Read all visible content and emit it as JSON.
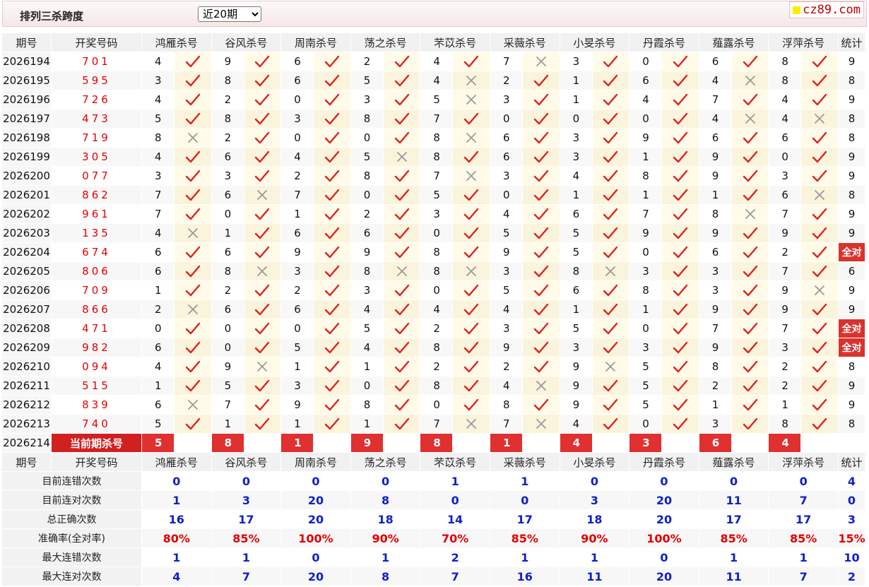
{
  "header": {
    "title": "排列三杀跨度",
    "period_selected": "近20期",
    "logo": "cz89.com"
  },
  "table": {
    "head": [
      "期号",
      "开奖号码",
      "鸿雁杀号",
      "谷风杀号",
      "周南杀号",
      "荡之杀号",
      "芣苡杀号",
      "采薇杀号",
      "小旻杀号",
      "丹霞杀号",
      "薤露杀号",
      "浮萍杀号",
      "统计"
    ],
    "rows": [
      {
        "id": "2026194",
        "num": "701",
        "k": [
          [
            4,
            1
          ],
          [
            9,
            1
          ],
          [
            6,
            1
          ],
          [
            2,
            1
          ],
          [
            4,
            1
          ],
          [
            7,
            0
          ],
          [
            3,
            1
          ],
          [
            0,
            1
          ],
          [
            6,
            1
          ],
          [
            8,
            1
          ]
        ],
        "stat": "9"
      },
      {
        "id": "2026195",
        "num": "595",
        "k": [
          [
            3,
            1
          ],
          [
            8,
            1
          ],
          [
            6,
            1
          ],
          [
            5,
            1
          ],
          [
            4,
            0
          ],
          [
            2,
            1
          ],
          [
            1,
            1
          ],
          [
            6,
            1
          ],
          [
            4,
            0
          ],
          [
            8,
            1
          ]
        ],
        "stat": "8"
      },
      {
        "id": "2026196",
        "num": "726",
        "k": [
          [
            4,
            1
          ],
          [
            2,
            1
          ],
          [
            0,
            1
          ],
          [
            3,
            1
          ],
          [
            5,
            0
          ],
          [
            3,
            1
          ],
          [
            1,
            1
          ],
          [
            4,
            1
          ],
          [
            7,
            1
          ],
          [
            4,
            1
          ]
        ],
        "stat": "9"
      },
      {
        "id": "2026197",
        "num": "473",
        "k": [
          [
            5,
            1
          ],
          [
            8,
            1
          ],
          [
            3,
            1
          ],
          [
            8,
            1
          ],
          [
            7,
            1
          ],
          [
            0,
            1
          ],
          [
            0,
            1
          ],
          [
            0,
            1
          ],
          [
            4,
            0
          ],
          [
            4,
            0
          ]
        ],
        "stat": "8"
      },
      {
        "id": "2026198",
        "num": "719",
        "k": [
          [
            8,
            0
          ],
          [
            2,
            1
          ],
          [
            0,
            1
          ],
          [
            0,
            1
          ],
          [
            8,
            0
          ],
          [
            6,
            1
          ],
          [
            3,
            1
          ],
          [
            9,
            1
          ],
          [
            6,
            1
          ],
          [
            6,
            1
          ]
        ],
        "stat": "8"
      },
      {
        "id": "2026199",
        "num": "305",
        "k": [
          [
            4,
            1
          ],
          [
            6,
            1
          ],
          [
            4,
            1
          ],
          [
            5,
            0
          ],
          [
            8,
            1
          ],
          [
            6,
            1
          ],
          [
            3,
            1
          ],
          [
            1,
            1
          ],
          [
            9,
            1
          ],
          [
            0,
            1
          ]
        ],
        "stat": "9"
      },
      {
        "id": "2026200",
        "num": "077",
        "k": [
          [
            3,
            1
          ],
          [
            3,
            1
          ],
          [
            2,
            1
          ],
          [
            8,
            1
          ],
          [
            7,
            0
          ],
          [
            3,
            1
          ],
          [
            4,
            1
          ],
          [
            8,
            1
          ],
          [
            9,
            1
          ],
          [
            3,
            1
          ]
        ],
        "stat": "9"
      },
      {
        "id": "2026201",
        "num": "862",
        "k": [
          [
            7,
            1
          ],
          [
            6,
            0
          ],
          [
            7,
            1
          ],
          [
            0,
            1
          ],
          [
            5,
            1
          ],
          [
            0,
            1
          ],
          [
            1,
            1
          ],
          [
            1,
            1
          ],
          [
            1,
            1
          ],
          [
            6,
            0
          ]
        ],
        "stat": "8"
      },
      {
        "id": "2026202",
        "num": "961",
        "k": [
          [
            7,
            1
          ],
          [
            0,
            1
          ],
          [
            1,
            1
          ],
          [
            2,
            1
          ],
          [
            3,
            1
          ],
          [
            4,
            1
          ],
          [
            6,
            1
          ],
          [
            7,
            1
          ],
          [
            8,
            0
          ],
          [
            7,
            1
          ]
        ],
        "stat": "9"
      },
      {
        "id": "2026203",
        "num": "135",
        "k": [
          [
            4,
            0
          ],
          [
            1,
            1
          ],
          [
            6,
            1
          ],
          [
            6,
            1
          ],
          [
            0,
            1
          ],
          [
            5,
            1
          ],
          [
            5,
            1
          ],
          [
            9,
            1
          ],
          [
            9,
            1
          ],
          [
            9,
            1
          ]
        ],
        "stat": "9"
      },
      {
        "id": "2026204",
        "num": "674",
        "k": [
          [
            6,
            1
          ],
          [
            6,
            1
          ],
          [
            9,
            1
          ],
          [
            9,
            1
          ],
          [
            8,
            1
          ],
          [
            9,
            1
          ],
          [
            5,
            1
          ],
          [
            0,
            1
          ],
          [
            6,
            1
          ],
          [
            2,
            1
          ]
        ],
        "stat": "全对",
        "full": true
      },
      {
        "id": "2026205",
        "num": "806",
        "k": [
          [
            6,
            1
          ],
          [
            8,
            0
          ],
          [
            3,
            1
          ],
          [
            8,
            0
          ],
          [
            8,
            0
          ],
          [
            3,
            1
          ],
          [
            8,
            0
          ],
          [
            3,
            1
          ],
          [
            3,
            1
          ],
          [
            7,
            1
          ]
        ],
        "stat": "6"
      },
      {
        "id": "2026206",
        "num": "709",
        "k": [
          [
            1,
            1
          ],
          [
            2,
            1
          ],
          [
            2,
            1
          ],
          [
            3,
            1
          ],
          [
            0,
            1
          ],
          [
            5,
            1
          ],
          [
            6,
            1
          ],
          [
            8,
            1
          ],
          [
            3,
            1
          ],
          [
            9,
            0
          ]
        ],
        "stat": "9"
      },
      {
        "id": "2026207",
        "num": "866",
        "k": [
          [
            2,
            0
          ],
          [
            6,
            1
          ],
          [
            6,
            1
          ],
          [
            4,
            1
          ],
          [
            4,
            1
          ],
          [
            4,
            1
          ],
          [
            1,
            1
          ],
          [
            1,
            1
          ],
          [
            9,
            1
          ],
          [
            9,
            1
          ]
        ],
        "stat": "9"
      },
      {
        "id": "2026208",
        "num": "471",
        "k": [
          [
            0,
            1
          ],
          [
            0,
            1
          ],
          [
            0,
            1
          ],
          [
            5,
            1
          ],
          [
            2,
            1
          ],
          [
            3,
            1
          ],
          [
            5,
            1
          ],
          [
            0,
            1
          ],
          [
            7,
            1
          ],
          [
            7,
            1
          ]
        ],
        "stat": "全对",
        "full": true
      },
      {
        "id": "2026209",
        "num": "982",
        "k": [
          [
            6,
            1
          ],
          [
            0,
            1
          ],
          [
            5,
            1
          ],
          [
            4,
            1
          ],
          [
            8,
            1
          ],
          [
            9,
            1
          ],
          [
            3,
            1
          ],
          [
            3,
            1
          ],
          [
            9,
            1
          ],
          [
            3,
            1
          ]
        ],
        "stat": "全对",
        "full": true
      },
      {
        "id": "2026210",
        "num": "094",
        "k": [
          [
            4,
            1
          ],
          [
            9,
            0
          ],
          [
            1,
            1
          ],
          [
            1,
            1
          ],
          [
            2,
            1
          ],
          [
            2,
            1
          ],
          [
            9,
            0
          ],
          [
            5,
            1
          ],
          [
            8,
            1
          ],
          [
            2,
            1
          ]
        ],
        "stat": "8"
      },
      {
        "id": "2026211",
        "num": "515",
        "k": [
          [
            1,
            1
          ],
          [
            5,
            1
          ],
          [
            3,
            1
          ],
          [
            0,
            1
          ],
          [
            8,
            1
          ],
          [
            4,
            0
          ],
          [
            9,
            1
          ],
          [
            5,
            1
          ],
          [
            2,
            1
          ],
          [
            2,
            1
          ]
        ],
        "stat": "9"
      },
      {
        "id": "2026212",
        "num": "839",
        "k": [
          [
            6,
            0
          ],
          [
            7,
            1
          ],
          [
            9,
            1
          ],
          [
            8,
            1
          ],
          [
            0,
            1
          ],
          [
            8,
            1
          ],
          [
            9,
            1
          ],
          [
            5,
            1
          ],
          [
            1,
            1
          ],
          [
            1,
            1
          ]
        ],
        "stat": "9"
      },
      {
        "id": "2026213",
        "num": "740",
        "k": [
          [
            5,
            1
          ],
          [
            1,
            1
          ],
          [
            1,
            1
          ],
          [
            1,
            1
          ],
          [
            7,
            0
          ],
          [
            7,
            0
          ],
          [
            4,
            1
          ],
          [
            0,
            1
          ],
          [
            3,
            1
          ],
          [
            8,
            1
          ]
        ],
        "stat": "8"
      }
    ],
    "current": {
      "id": "2026214",
      "label": "当前期杀号",
      "values": [
        "5",
        "8",
        "1",
        "9",
        "8",
        "1",
        "4",
        "3",
        "6",
        "4"
      ]
    },
    "stats": [
      {
        "label": "目前连错次数",
        "values": [
          "0",
          "0",
          "0",
          "0",
          "1",
          "1",
          "0",
          "0",
          "0",
          "0",
          "4"
        ]
      },
      {
        "label": "目前连对次数",
        "values": [
          "1",
          "3",
          "20",
          "8",
          "0",
          "0",
          "3",
          "20",
          "11",
          "7",
          "0"
        ]
      },
      {
        "label": "总正确次数",
        "values": [
          "16",
          "17",
          "20",
          "18",
          "14",
          "17",
          "18",
          "20",
          "17",
          "17",
          "3"
        ]
      },
      {
        "label": "准确率(全对率)",
        "values": [
          "80%",
          "85%",
          "100%",
          "90%",
          "70%",
          "85%",
          "90%",
          "100%",
          "85%",
          "85%",
          "15%"
        ],
        "red": true
      },
      {
        "label": "最大连错次数",
        "values": [
          "1",
          "1",
          "0",
          "1",
          "2",
          "1",
          "1",
          "0",
          "1",
          "1",
          "10"
        ]
      },
      {
        "label": "最大连对次数",
        "values": [
          "4",
          "7",
          "20",
          "8",
          "7",
          "16",
          "11",
          "20",
          "11",
          "7",
          "2"
        ]
      }
    ]
  },
  "colors": {
    "check": "#e02020",
    "cross": "#9a9a9a",
    "red_fill": "#d9332e",
    "stat_blue": "#1020c8",
    "stat_red": "#e40000"
  },
  "icons": {
    "hit": "check-icon",
    "miss": "cross-icon"
  }
}
